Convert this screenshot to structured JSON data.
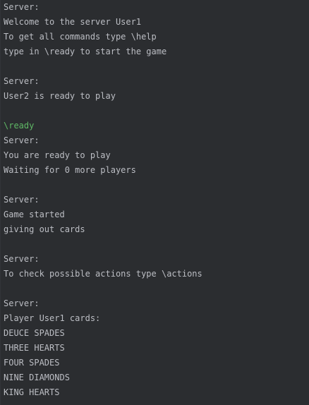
{
  "console": {
    "lines": [
      {
        "text": "Server:",
        "kind": "output"
      },
      {
        "text": "Welcome to the server User1",
        "kind": "output"
      },
      {
        "text": "To get all commands type \\help",
        "kind": "output"
      },
      {
        "text": "type in \\ready to start the game",
        "kind": "output"
      },
      {
        "text": "",
        "kind": "blank"
      },
      {
        "text": "Server:",
        "kind": "output"
      },
      {
        "text": "User2 is ready to play",
        "kind": "output"
      },
      {
        "text": "",
        "kind": "blank"
      },
      {
        "text": "\\ready",
        "kind": "input"
      },
      {
        "text": "Server:",
        "kind": "output"
      },
      {
        "text": "You are ready to play",
        "kind": "output"
      },
      {
        "text": "Waiting for 0 more players",
        "kind": "output"
      },
      {
        "text": "",
        "kind": "blank"
      },
      {
        "text": "Server:",
        "kind": "output"
      },
      {
        "text": "Game started",
        "kind": "output"
      },
      {
        "text": "giving out cards",
        "kind": "output"
      },
      {
        "text": "",
        "kind": "blank"
      },
      {
        "text": "Server:",
        "kind": "output"
      },
      {
        "text": "To check possible actions type \\actions",
        "kind": "output"
      },
      {
        "text": "",
        "kind": "blank"
      },
      {
        "text": "Server:",
        "kind": "output"
      },
      {
        "text": "Player User1 cards:",
        "kind": "output"
      },
      {
        "text": "DEUCE SPADES",
        "kind": "output"
      },
      {
        "text": "THREE HEARTS",
        "kind": "output"
      },
      {
        "text": "FOUR SPADES",
        "kind": "output"
      },
      {
        "text": "NINE DIAMONDS",
        "kind": "output"
      },
      {
        "text": "KING HEARTS",
        "kind": "output"
      }
    ]
  },
  "colors": {
    "background": "#2b2d30",
    "output_text": "#bcbec4",
    "user_input_text": "#5fb865"
  }
}
